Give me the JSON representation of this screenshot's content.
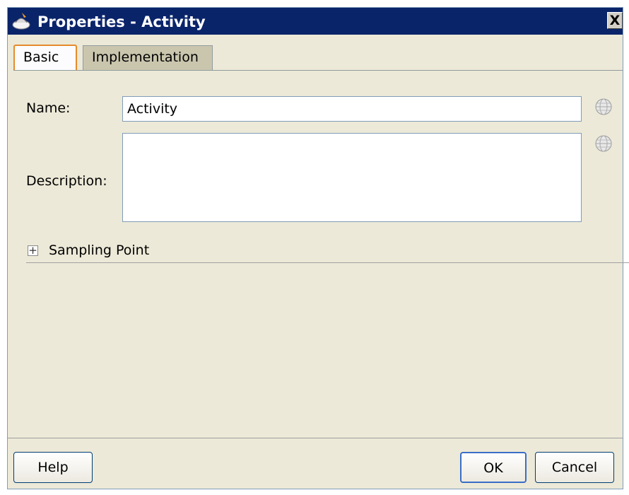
{
  "window": {
    "title": "Properties - Activity",
    "close_label": "X"
  },
  "tabs": [
    {
      "label": "Basic",
      "active": true
    },
    {
      "label": "Implementation",
      "active": false
    }
  ],
  "form": {
    "name_label": "Name:",
    "name_value": "Activity",
    "description_label": "Description:",
    "description_value": "",
    "section_expander": "+",
    "section_label": "Sampling Point"
  },
  "buttons": {
    "help": "Help",
    "ok": "OK",
    "cancel": "Cancel"
  },
  "colors": {
    "titlebar": "#0a246a",
    "dialog_bg": "#ece9d8",
    "active_tab_border": "#e68b2c"
  }
}
